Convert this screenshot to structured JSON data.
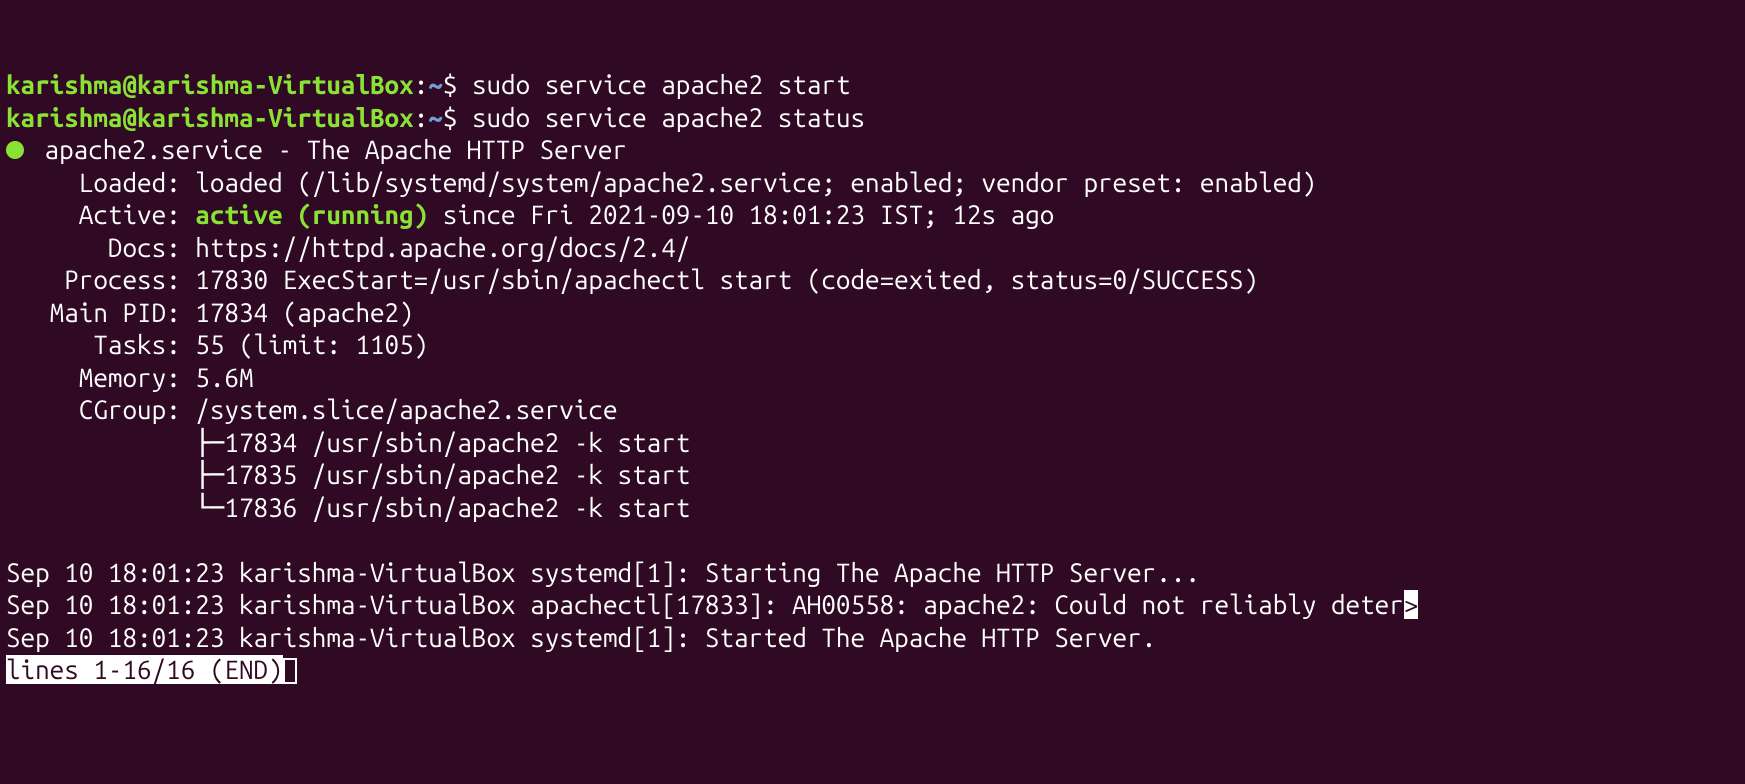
{
  "prompt1": {
    "user": "karishma@karishma-VirtualBox",
    "sep": ":",
    "path": "~",
    "dollar": "$ ",
    "cmd": "sudo service apache2 start"
  },
  "prompt2": {
    "user": "karishma@karishma-VirtualBox",
    "sep": ":",
    "path": "~",
    "dollar": "$ ",
    "cmd": "sudo service apache2 status"
  },
  "status": {
    "title_line": " apache2.service - The Apache HTTP Server",
    "loaded": "     Loaded: loaded (/lib/systemd/system/apache2.service; enabled; vendor preset: enabled)",
    "active_pre": "     Active: ",
    "active_val": "active (running)",
    "active_post": " since Fri 2021-09-10 18:01:23 IST; 12s ago",
    "docs": "       Docs: https://httpd.apache.org/docs/2.4/",
    "process": "    Process: 17830 ExecStart=/usr/sbin/apachectl start (code=exited, status=0/SUCCESS)",
    "mainpid": "   Main PID: 17834 (apache2)",
    "tasks": "      Tasks: 55 (limit: 1105)",
    "memory": "     Memory: 5.6M",
    "cgroup": "     CGroup: /system.slice/apache2.service",
    "cg1": "             ├─17834 /usr/sbin/apache2 -k start",
    "cg2": "             ├─17835 /usr/sbin/apache2 -k start",
    "cg3": "             └─17836 /usr/sbin/apache2 -k start"
  },
  "logs": {
    "l1": "Sep 10 18:01:23 karishma-VirtualBox systemd[1]: Starting The Apache HTTP Server...",
    "l2_main": "Sep 10 18:01:23 karishma-VirtualBox apachectl[17833]: AH00558: apache2: Could not reliably deter",
    "l2_trunc": ">",
    "l3": "Sep 10 18:01:23 karishma-VirtualBox systemd[1]: Started The Apache HTTP Server."
  },
  "pager": "lines 1-16/16 (END)"
}
